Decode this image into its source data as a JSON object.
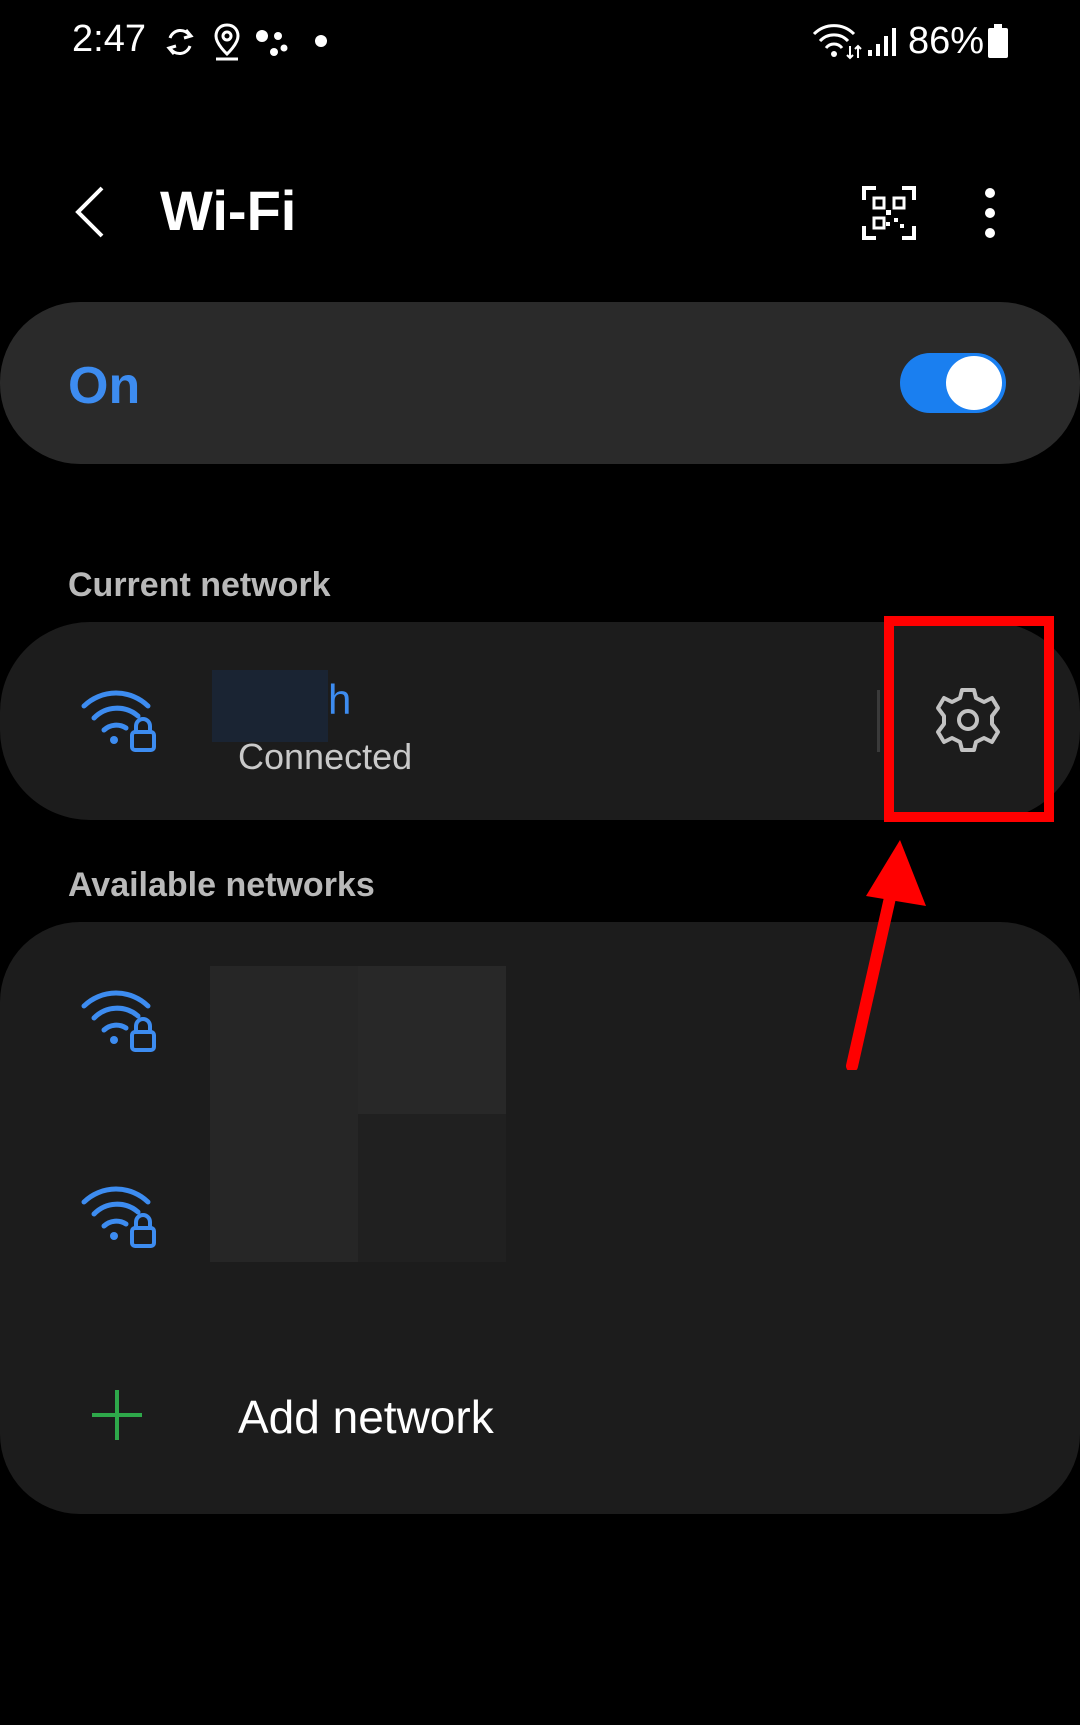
{
  "status_bar": {
    "time": "2:47",
    "battery": "86%"
  },
  "header": {
    "title": "Wi-Fi",
    "icons": [
      "back-arrow-icon",
      "qr-scanner-icon",
      "more-options-icon"
    ]
  },
  "wifi_toggle": {
    "label": "On",
    "enabled": true
  },
  "current_network": {
    "section_label": "Current network",
    "name": "h",
    "status": "Connected"
  },
  "available_networks": {
    "section_label": "Available networks",
    "add_network_label": "Add network"
  },
  "colors": {
    "accent": "#3d8cf0",
    "switch_on": "#1a7ff0",
    "add_icon": "#2ea84a",
    "annotation": "#ff0000",
    "card_bg": "#1c1c1c",
    "toggle_card_bg": "#2a2a2a"
  }
}
